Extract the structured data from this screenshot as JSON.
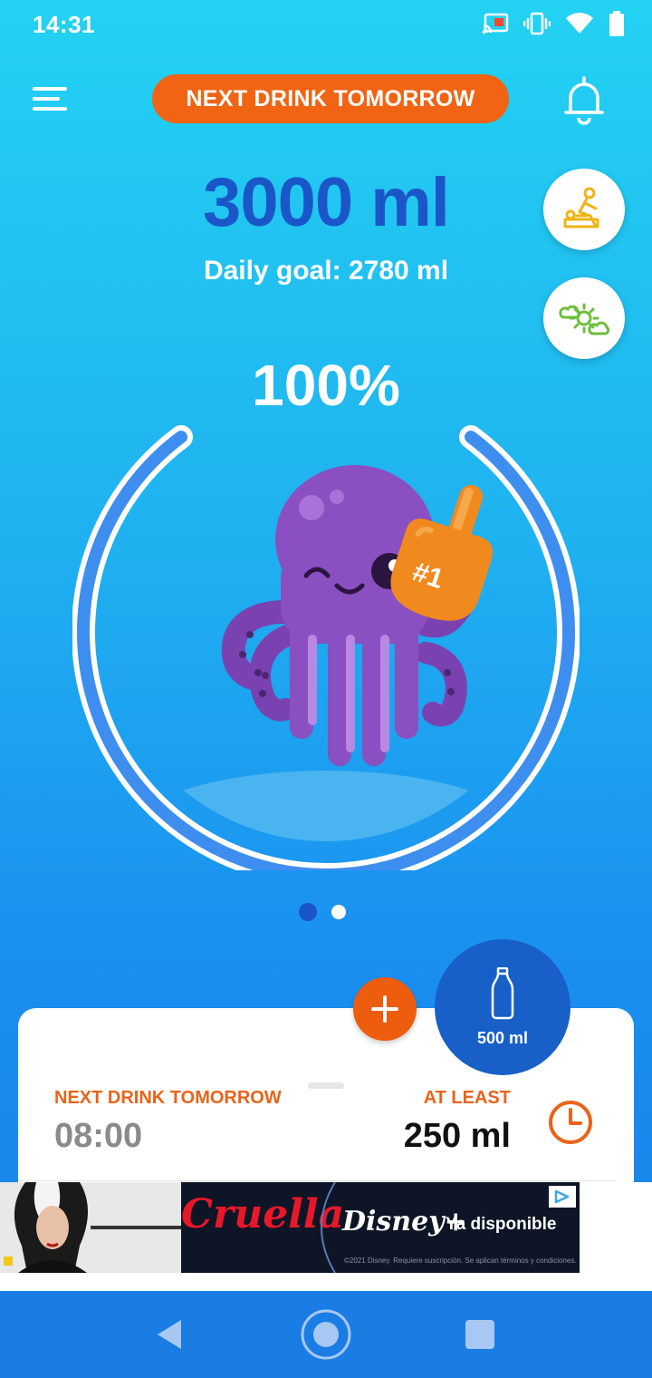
{
  "status_bar": {
    "time": "14:31",
    "icons": [
      "cast-icon",
      "vibrate-icon",
      "wifi-icon",
      "battery-icon"
    ]
  },
  "header": {
    "menu_icon": "menu-icon",
    "banner_label": "NEXT DRINK TOMORROW",
    "bell_icon": "bell-icon"
  },
  "intake": {
    "amount": "3000 ml",
    "goal": "Daily goal: 2780 ml",
    "percent": "100%",
    "progress": 1.0
  },
  "side_buttons": [
    {
      "icon": "massage-activity-icon",
      "color": "#f0b414"
    },
    {
      "icon": "weather-sun-cloud-icon",
      "color": "#6cbf3a"
    }
  ],
  "pager": {
    "pages": 2,
    "active": 0
  },
  "card": {
    "next_label": "NEXT DRINK TOMORROW",
    "next_time": "08:00",
    "least_label": "AT LEAST",
    "least_value": "250 ml",
    "clock_icon": "clock-icon"
  },
  "actions": {
    "add_icon": "plus-icon",
    "cup_label": "500 ml",
    "cup_icon": "bottle-icon"
  },
  "ad": {
    "brand": "Cruella",
    "disney": "Disney+",
    "cta": "Ya disponible",
    "fine_print": "©2021 Disney. Requiere suscripción. Se aplican términos y condiciones."
  },
  "navbar": {
    "back_icon": "back-icon",
    "home_icon": "home-icon",
    "recents_icon": "recents-icon"
  },
  "colors": {
    "accent_orange": "#f06414",
    "primary_blue": "#1a56c8",
    "octopus": "#8a4fc0"
  }
}
